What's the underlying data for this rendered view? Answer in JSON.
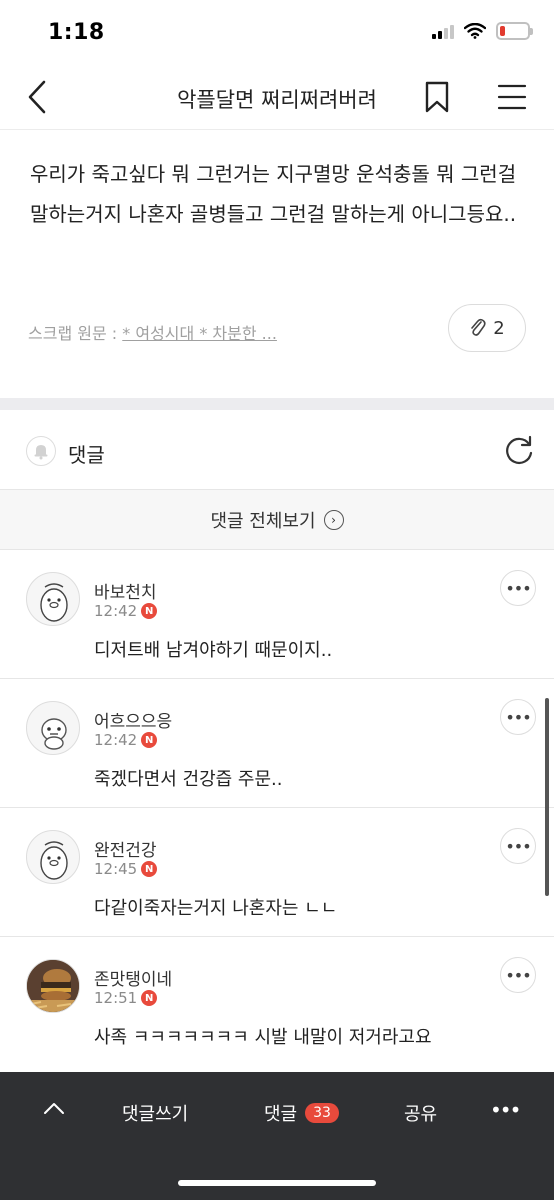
{
  "status_bar": {
    "time": "1:18",
    "battery_level": 0.2,
    "battery_color": "#e23b2f"
  },
  "nav": {
    "title": "악플달면 쩌리쩌려버려",
    "back_icon": "chevron-left-icon",
    "bookmark_icon": "bookmark-icon",
    "menu_icon": "hamburger-menu-icon"
  },
  "post": {
    "body": "우리가 죽고싶다 뭐 그런거는 지구멸망 운석충돌 뭐 그런걸 말하는거지 나혼자 골병들고 그런걸 말하는게 아니그등요..",
    "scrap_label": "스크랩 원문 :",
    "scrap_link": "* 여성시대 *  차분한 ...",
    "attachment_count": "2"
  },
  "comments_section": {
    "label": "댓글",
    "view_all": "댓글 전체보기",
    "badge_letter": "N",
    "badge_color": "#e84a3c",
    "items": [
      {
        "name": "바보천치",
        "time": "12:42",
        "text": "디저트배 남겨야하기 때문이지..",
        "avatar": "penguin-avatar"
      },
      {
        "name": "어흐으으응",
        "time": "12:42",
        "text": "죽겠다면서 건강즙 주문..",
        "avatar": "character-avatar"
      },
      {
        "name": "완전건강",
        "time": "12:45",
        "text": "다같이죽자는거지 나혼자는 ㄴㄴ",
        "avatar": "penguin-avatar"
      },
      {
        "name": "존맛탱이네",
        "time": "12:51",
        "text": "사족 ㅋㅋㅋㅋㅋㅋㅋ 시발 내말이 저거라고요",
        "avatar": "burger-photo-avatar"
      }
    ]
  },
  "bottom_bar": {
    "write": "댓글쓰기",
    "comments": "댓글",
    "comment_count": "33",
    "share": "공유"
  }
}
